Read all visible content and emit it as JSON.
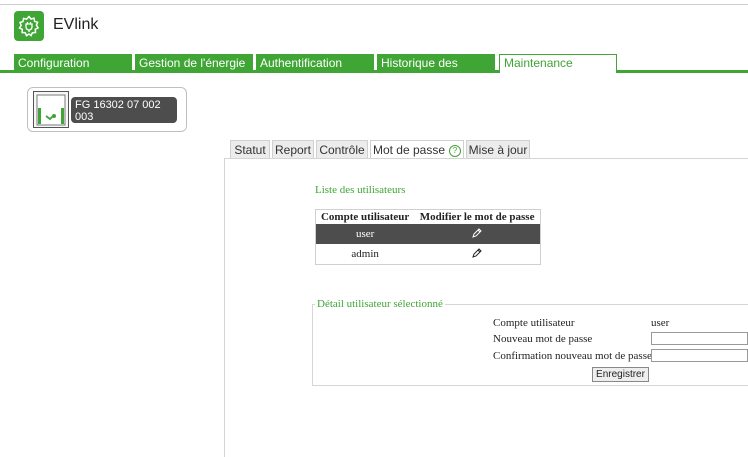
{
  "app": {
    "name": "EVlink"
  },
  "nav": {
    "items": [
      {
        "label": "Configuration"
      },
      {
        "label": "Gestion de l'énergie"
      },
      {
        "label": "Authentification"
      },
      {
        "label": "Historique des charges"
      },
      {
        "label": "Maintenance"
      }
    ],
    "active": "Maintenance"
  },
  "station": {
    "id": "FG 16302 07 002 003",
    "status": "en service"
  },
  "tabs": {
    "items": [
      {
        "label": "Statut"
      },
      {
        "label": "Report"
      },
      {
        "label": "Contrôle"
      },
      {
        "label": "Mot de passe"
      },
      {
        "label": "Mise à jour"
      }
    ],
    "active": "Mot de passe",
    "help_glyph": "?"
  },
  "users_section": {
    "title": "Liste des utilisateurs",
    "columns": [
      "Compte utilisateur",
      "Modifier le mot de passe"
    ],
    "rows": [
      {
        "account": "user",
        "edit_icon": "pencil-icon",
        "selected": true
      },
      {
        "account": "admin",
        "edit_icon": "pencil-icon",
        "selected": false
      }
    ]
  },
  "detail_section": {
    "title": "Détail utilisateur sélectionné",
    "account_label": "Compte utilisateur",
    "account_value": "user",
    "new_password_label": "Nouveau mot de passe",
    "new_password_value": "",
    "confirm_password_label": "Confirmation nouveau mot de passe",
    "confirm_password_value": "",
    "save_label": "Enregistrer"
  },
  "colors": {
    "brand_green": "#3fa535",
    "selected_row": "#4d4d4d"
  }
}
